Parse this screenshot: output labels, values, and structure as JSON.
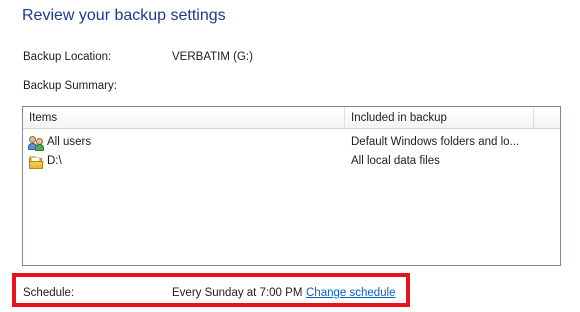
{
  "header": {
    "title": "Review your backup settings"
  },
  "settings": {
    "backup_location_label": "Backup Location:",
    "backup_location_value": "VERBATIM (G:)",
    "backup_summary_label": "Backup Summary:"
  },
  "summary_table": {
    "columns": [
      "Items",
      "Included in backup"
    ],
    "rows": [
      {
        "item": "All users",
        "icon": "users-icon",
        "included": "Default Windows folders and lo..."
      },
      {
        "item": "D:\\",
        "icon": "folder-icon",
        "included": "All local data files"
      }
    ]
  },
  "schedule": {
    "label": "Schedule:",
    "value": "Every Sunday at 7:00 PM",
    "change_link": "Change schedule",
    "highlight_color": "#e8121d"
  },
  "colors": {
    "title": "#1e3a8c",
    "link": "#0b5fc4"
  }
}
